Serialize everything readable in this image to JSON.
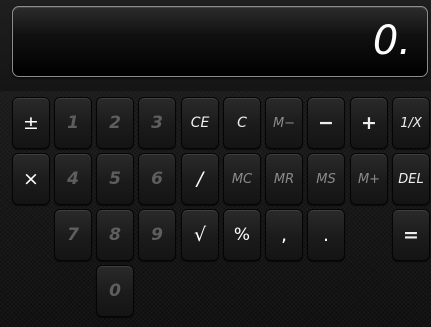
{
  "display": {
    "value": "0."
  },
  "keys": {
    "plus_minus": "±",
    "one": "1",
    "two": "2",
    "three": "3",
    "ce": "CE",
    "c": "C",
    "m_minus": "M−",
    "minus": "−",
    "plus": "+",
    "reciprocal": "1/X",
    "multiply": "×",
    "four": "4",
    "five": "5",
    "six": "6",
    "divide": "/",
    "mc": "MC",
    "mr": "MR",
    "ms": "MS",
    "m_plus": "M+",
    "del": "DEL",
    "seven": "7",
    "eight": "8",
    "nine": "9",
    "sqrt": "√",
    "percent": "%",
    "comma": ",",
    "decimal": ".",
    "equals": "=",
    "zero": "0"
  }
}
